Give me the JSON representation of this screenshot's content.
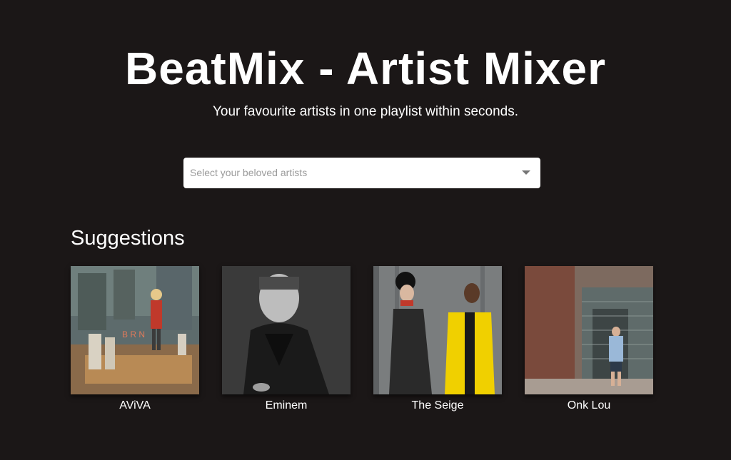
{
  "header": {
    "title": "BeatMix - Artist Mixer",
    "subtitle": "Your favourite artists in one playlist within seconds."
  },
  "artist_select": {
    "placeholder": "Select your beloved artists",
    "icon": "chevron-down-icon"
  },
  "suggestions": {
    "heading": "Suggestions",
    "artists": [
      {
        "name": "AViVA",
        "image": "aviva-album-art"
      },
      {
        "name": "Eminem",
        "image": "eminem-photo"
      },
      {
        "name": "The Seige",
        "image": "the-seige-photo"
      },
      {
        "name": "Onk Lou",
        "image": "onk-lou-photo"
      }
    ]
  },
  "colors": {
    "background": "#1b1717",
    "text": "#ffffff",
    "input_bg": "#ffffff",
    "placeholder": "#9a9a9a"
  }
}
